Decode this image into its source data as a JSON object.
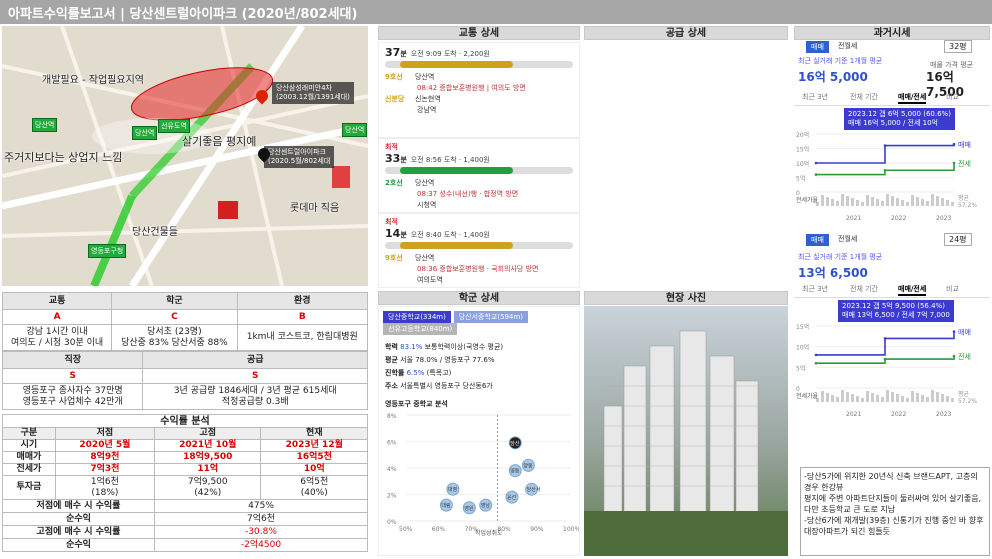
{
  "title": "아파트수익률보고서 | 당산센트럴아이파크 (2020년/802세대)",
  "panels": {
    "traffic": "교통 상세",
    "supply": "공급 상세",
    "past": "과거시세",
    "school": "학군 상세",
    "site": "현장 사진"
  },
  "map": {
    "labels": [
      "개발필요 - 작업필요지역",
      "살기좋음 평지예",
      "주거지보다는 상업지 느낌",
      "롯데마 직음",
      "당산건물들"
    ],
    "pin1": [
      "당산삼성래미안4차",
      "(2003.12월/1391세대)"
    ],
    "pin2": [
      "당산센트럴아이파크",
      "(2020.5월/802세대"
    ],
    "tags": [
      "당산역",
      "당산역",
      "선유도역",
      "당산역",
      "영등포구청"
    ]
  },
  "summary": {
    "cat1": "교통",
    "cat2": "학군",
    "cat3": "환경",
    "grade1": "A",
    "grade2": "C",
    "grade3": "B",
    "desc1": "강남 1시간 이내\n여의도 / 시청 30분 이내",
    "desc2": "당서초 (23명)\n당산중 83% 당산서중 88%",
    "desc3": "1km내 코스트코, 한림대병원",
    "cat4": "직장",
    "cat5": "공급",
    "grade4": "S",
    "grade5": "S",
    "desc4": "영등포구 종사자수 37만명\n영등포구 사업체수 42만개",
    "desc5": "3년 공급량 1846세대 / 3년 평균 615세대\n적정공급량 0.3배"
  },
  "returns": {
    "title": "수익률 분석",
    "cols": [
      "구분",
      "저점",
      "고점",
      "현재"
    ],
    "rows": [
      [
        "시기",
        "2020년 5월",
        "2021년 10월",
        "2023년 12월"
      ],
      [
        "매매가",
        "8억9천",
        "18억9,500",
        "16억5천"
      ],
      [
        "전세가",
        "7억3천",
        "11억",
        "10억"
      ],
      [
        "투자금",
        "1억6천\n(18%)",
        "7억9,500\n(42%)",
        "6억5천\n(40%)"
      ]
    ],
    "r1": "저점에 매수 시 수익률",
    "v1": "475%",
    "r2": "순수익",
    "v2": "7억6천",
    "r3": "고점에 매수 시 수익률",
    "v3": "-30.8%",
    "r4": "순수익",
    "v4": "-2억4500"
  },
  "traffic": [
    {
      "tag": "",
      "mins": "37",
      "unit": "분",
      "info": "오전 9:09 도착 · 2,200원",
      "stops": [
        [
          "9호선",
          "당산역"
        ],
        [
          "",
          "08:42 증합보훈병원행 | 여의도 방면"
        ],
        [
          "신분당",
          "신논현역"
        ],
        [
          "",
          "강남역"
        ]
      ]
    },
    {
      "tag": "최적",
      "mins": "33",
      "unit": "분",
      "info": "오전 8:56 도착 · 1,400원",
      "stops": [
        [
          "2호선",
          "당산역"
        ],
        [
          "",
          "08:37 성수(내선)행 · 합정역 방면"
        ],
        [
          "",
          "시청역"
        ]
      ]
    },
    {
      "tag": "최적",
      "mins": "14",
      "unit": "분",
      "info": "오전 8:40 도착 · 1,400원",
      "stops": [
        [
          "9호선",
          "당산역"
        ],
        [
          "",
          "08:36 증합보훈병원행 · 국회의사당 방면"
        ],
        [
          "",
          "여의도역"
        ]
      ]
    }
  ],
  "past": {
    "tabs": [
      "매매",
      "전월세"
    ],
    "select": "32평",
    "lbl1": "최근 실거래 기준 1개월 평균",
    "p1": "16억 5,000",
    "lbl2": "매물 가격 평균",
    "p2": "16억 7,500",
    "subtabs": [
      "최근 3년",
      "전체 기간",
      "매매/전세",
      "비교"
    ],
    "tip1a": "2023.12  갭 6억 5,000 (60.6%)",
    "tip1b": "매매 16억 5,000 / 전세 10억",
    "ylabels": [
      "20억",
      "15억",
      "10억",
      "5억",
      "0"
    ],
    "side": [
      "매매",
      "전세"
    ],
    "gaplbl": "전세가율",
    "gapv": "평균",
    "gapn": "57.2%",
    "years": [
      "2021",
      "2022",
      "2023"
    ],
    "select2": "24평",
    "p3": "13억 6,500",
    "tip2a": "2023.12  갭 5억 9,500 (56.4%)",
    "tip2b": "매매 13억 6,500 / 전세 7억 7,000",
    "ylabels2": [
      "15억",
      "10억",
      "5억",
      "0"
    ],
    "gapn2": "57.2%"
  },
  "chart_data": [
    {
      "type": "line",
      "title": "",
      "xlabel": "",
      "ylabel": "",
      "x": [
        "2021",
        "2022",
        "2023"
      ],
      "ylim": [
        0,
        20
      ],
      "series": [
        {
          "name": "매매",
          "values": [
            10,
            16,
            16.5
          ]
        },
        {
          "name": "전세",
          "values": [
            6,
            7.5,
            10
          ]
        }
      ]
    },
    {
      "type": "line",
      "title": "",
      "xlabel": "",
      "ylabel": "",
      "x": [
        "2021",
        "2022",
        "2023"
      ],
      "ylim": [
        0,
        15
      ],
      "series": [
        {
          "name": "매매",
          "values": [
            8,
            12,
            13.65
          ]
        },
        {
          "name": "전세",
          "values": [
            6,
            7,
            7.7
          ]
        }
      ]
    },
    {
      "type": "scatter",
      "title": "영등포구 중학교 분석",
      "xlabel": "학업성취도",
      "ylabel": "",
      "xlim": [
        0.5,
        1.0
      ],
      "ylim": [
        0,
        8
      ],
      "x_ticks": [
        "50%",
        "60%",
        "70%",
        "80%",
        "90%",
        "100%"
      ],
      "y_ticks": [
        "0%",
        "2%",
        "4%",
        "6%",
        "8%"
      ],
      "points": [
        {
          "label": "당산",
          "x": 0.83,
          "y": 5.9
        },
        {
          "label": "양동",
          "x": 0.87,
          "y": 4.2
        },
        {
          "label": "영등",
          "x": 0.83,
          "y": 3.8
        },
        {
          "label": "당산서",
          "x": 0.88,
          "y": 2.4
        },
        {
          "label": "대영",
          "x": 0.64,
          "y": 2.4
        },
        {
          "label": "대림",
          "x": 0.62,
          "y": 1.2
        },
        {
          "label": "영원",
          "x": 0.69,
          "y": 1.0
        },
        {
          "label": "윤선",
          "x": 0.82,
          "y": 1.8
        },
        {
          "label": "영남",
          "x": 0.74,
          "y": 1.2
        }
      ]
    }
  ],
  "school": {
    "tabs": [
      "당산중학교(334m)",
      "당산서중학교(594m)",
      "선유고등학교(840m)"
    ],
    "l1": "학력",
    "v1": "83.1%",
    "t1": "보통학력이상(국영수 평균)",
    "l2": "평균",
    "v2": "서울 78.0% / 영등포구 77.6%",
    "l3": "진학률",
    "v3": "6.5%",
    "t3": "(특목고)",
    "l4": "주소",
    "v4": "서울특별시 영등포구 당산동6가",
    "chart_title": "영등포구 중학교 분석",
    "xaxis": "학업성취도"
  },
  "notes": "-당산5가에 위치한 20년식 신축 브랜드APT, 고층의 경우 한강뷰\n평지에 주변 아파트단지들이 둘러싸여 있어 살기좋음,다만 초등학교 큰 도로 지남\n-당산6가에 재개발(39층) 신통기가 진행 중인 바 향후 대장아파트가 되긴 힘들듯"
}
